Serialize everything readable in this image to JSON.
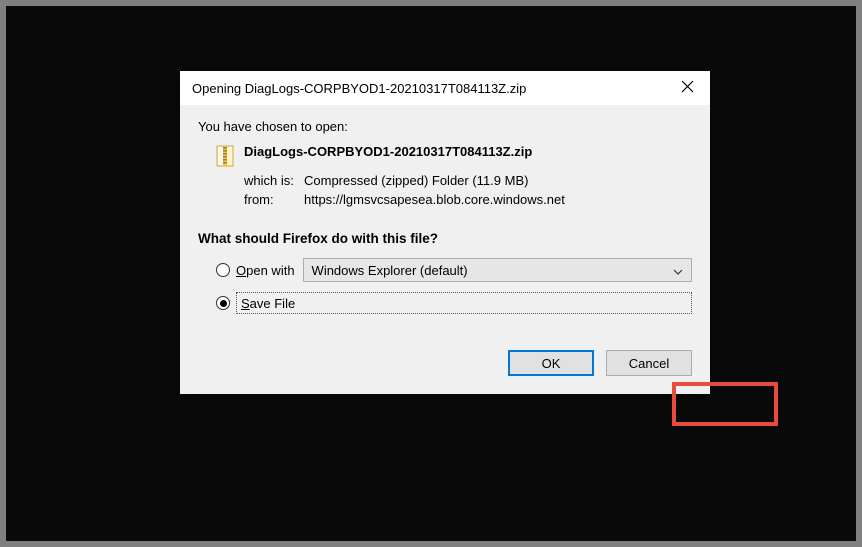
{
  "titlebar": {
    "text": "Opening DiagLogs-CORPBYOD1-20210317T084113Z.zip"
  },
  "intro": "You have chosen to open:",
  "file": {
    "name": "DiagLogs-CORPBYOD1-20210317T084113Z.zip",
    "which_label": "which is:",
    "which_value": "Compressed (zipped) Folder (11.9 MB)",
    "from_label": "from:",
    "from_value": "https://lgmsvcsapesea.blob.core.windows.net"
  },
  "question": "What should Firefox do with this file?",
  "open_with": {
    "label_pre": "O",
    "label_rest": "pen with",
    "combo_value": "Windows Explorer (default)"
  },
  "save_file": {
    "label_pre": "S",
    "label_rest": "ave File"
  },
  "buttons": {
    "ok": "OK",
    "cancel": "Cancel"
  }
}
